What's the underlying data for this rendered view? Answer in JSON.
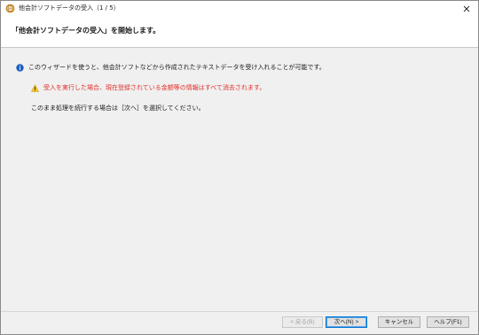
{
  "window": {
    "title": "他会計ソフトデータの受入（1 / 5）",
    "icons": {
      "app": "app-icon",
      "close": "close-icon"
    }
  },
  "header": {
    "title": "「他会計ソフトデータの受入」を開始します。"
  },
  "content": {
    "info_text": "このウィザードを使うと、他会計ソフトなどから作成されたテキストデータを受け入れることが可能です。",
    "warning_text": "受入を実行した場合、現在登録されている金額等の情報はすべて消去されます。",
    "note_text": "このまま処理を続行する場合は［次へ］を選択してください。",
    "icons": {
      "info": "info-icon",
      "warning": "warning-icon"
    },
    "warning_color": "#e0302a"
  },
  "footer": {
    "back_label": "< 戻る(B)",
    "next_label": "次へ(N) >",
    "cancel_label": "キャンセル",
    "help_label": "ヘルプ(F1)"
  }
}
